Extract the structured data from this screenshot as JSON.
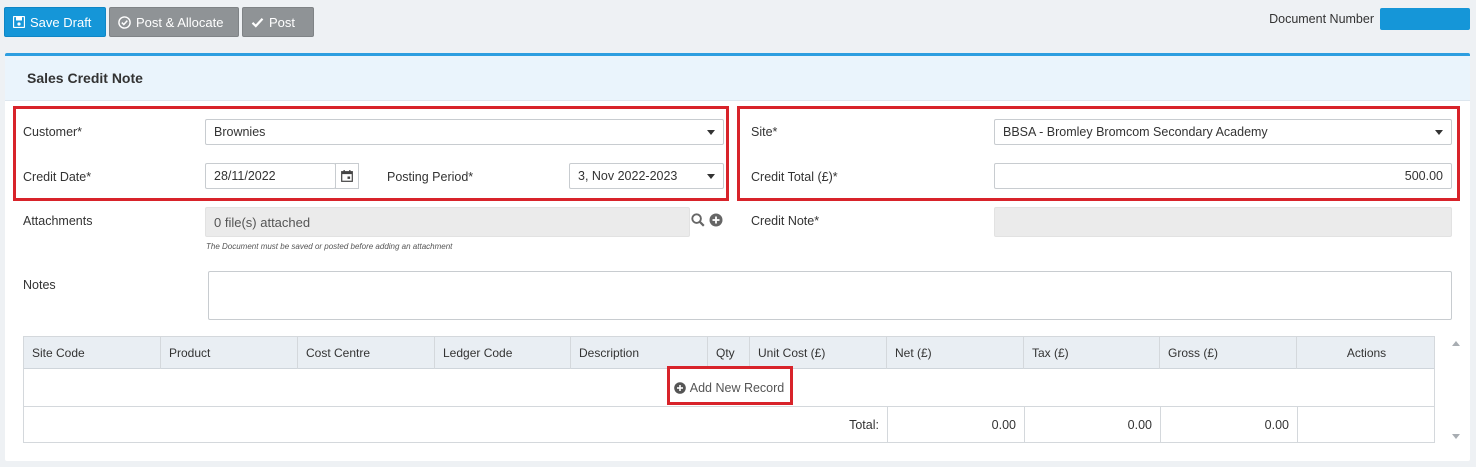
{
  "toolbar": {
    "save_draft": "Save Draft",
    "post_allocate": "Post & Allocate",
    "post": "Post",
    "document_number_label": "Document Number"
  },
  "panel": {
    "title": "Sales Credit Note"
  },
  "form": {
    "customer_label": "Customer*",
    "customer_value": "Brownies",
    "credit_date_label": "Credit Date*",
    "credit_date_value": "28/11/2022",
    "posting_period_label": "Posting Period*",
    "posting_period_value": "3, Nov 2022-2023",
    "site_label": "Site*",
    "site_value": "BBSA - Bromley Bromcom Secondary Academy",
    "credit_total_label": "Credit Total (£)*",
    "credit_total_value": "500.00",
    "attachments_label": "Attachments",
    "attachments_value": "0 file(s) attached",
    "attachments_hint": "The Document must be saved or posted before adding an attachment",
    "credit_note_label": "Credit Note*",
    "credit_note_value": "",
    "notes_label": "Notes",
    "notes_value": ""
  },
  "grid": {
    "columns": [
      "Site Code",
      "Product",
      "Cost Centre",
      "Ledger Code",
      "Description",
      "Qty",
      "Unit Cost (£)",
      "Net (£)",
      "Tax (£)",
      "Gross (£)",
      "Actions"
    ],
    "add_record": "Add New Record",
    "total_label": "Total:",
    "total_net": "0.00",
    "total_tax": "0.00",
    "total_gross": "0.00"
  },
  "colors": {
    "primary": "#1596d8",
    "secondary_button": "#8f9396",
    "highlight": "#d8232a",
    "panel_border": "#2d9ee0"
  },
  "icons": {
    "save": "floppy-icon",
    "post_allocate": "check-circle-icon",
    "post": "check-icon",
    "calendar": "calendar-icon",
    "search": "search-icon",
    "add": "plus-circle-icon"
  }
}
